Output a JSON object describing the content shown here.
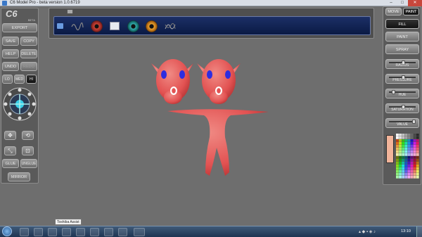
{
  "window": {
    "title": "C6 Model Pro - beta version 1.0.6719",
    "minimize": "–",
    "maximize": "□",
    "close": "✕"
  },
  "logo": {
    "text": "C6",
    "sub": "BETA"
  },
  "left_buttons": {
    "export": "EXPORT",
    "save": "SAVE",
    "copy": "COPY",
    "help": "HELP",
    "delete": "DELETE",
    "undo": "UNDO",
    "redo": "REDO",
    "lo": "LO",
    "med": "MED",
    "hi": "HI",
    "glue": "GLUE",
    "unglue": "UNGLUE",
    "mirror": "MIRROR"
  },
  "right_panel": {
    "mode_move": "MOVE",
    "mode_paint": "PAINT",
    "fill": "FILL",
    "paint": "PAINT",
    "spray": "SPRAY",
    "radius": "RADIUS",
    "pressure": "PRESSURE",
    "hue": "HUE",
    "saturation": "SATURATION",
    "value": "VALUE",
    "radius_level": 0.5,
    "pressure_level": 0.5,
    "hue_level": 0.1,
    "saturation_level": 0.5,
    "value_level": 0.95,
    "current_color": "#f2b49a"
  },
  "texture_strip": {
    "items": [
      "folder-icon",
      "scribble-texture",
      "red-eye-texture",
      "white-swatch-texture",
      "teal-eye-texture",
      "orange-eye-texture",
      "dark-swirl-texture"
    ]
  },
  "model": {
    "body_color": "#e45a5a",
    "eye_color": "#2d2de0"
  },
  "taskbar": {
    "tooltip": "Toshiba Assist",
    "clock": "13:10"
  }
}
